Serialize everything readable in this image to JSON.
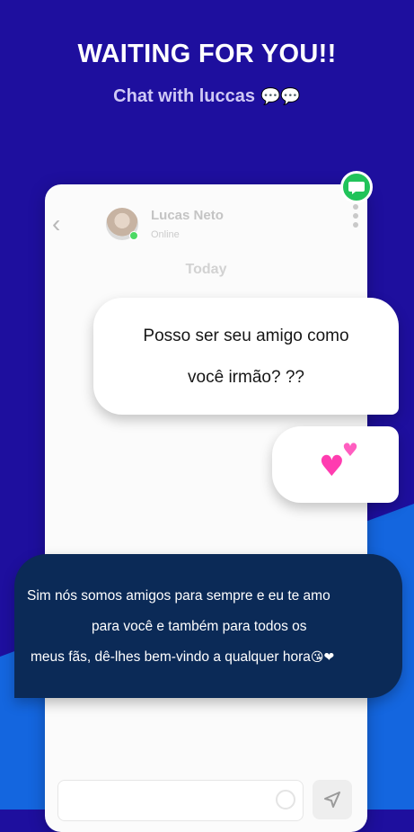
{
  "header": {
    "headline": "WAITING FOR YOU!!",
    "subline": "Chat with luccas",
    "subline_emoji": "💬💬"
  },
  "chat": {
    "contact_name": "Lucas Neto",
    "contact_status": "Online",
    "day_separator": "Today"
  },
  "messages": [
    {
      "lines": [
        "Posso ser seu amigo como",
        "você irmão? ??"
      ]
    },
    {
      "lines": [
        "💕"
      ]
    },
    {
      "lines": [
        "Sim nós somos amigos para sempre e eu te amo",
        "para você e também para todos os",
        "meus fãs, dê-lhes bem-vindo a qualquer hora",
        "😘❤"
      ]
    }
  ],
  "colors": {
    "background_top": "#1e0f9e",
    "background_bottom": "#1565e0",
    "dark_bubble": "#0b2a57",
    "badge": "#21c35a"
  },
  "icons": [
    "back-arrow-icon",
    "more-vertical-icon",
    "chat-bubble-icon",
    "send-icon",
    "emoji-icon"
  ]
}
